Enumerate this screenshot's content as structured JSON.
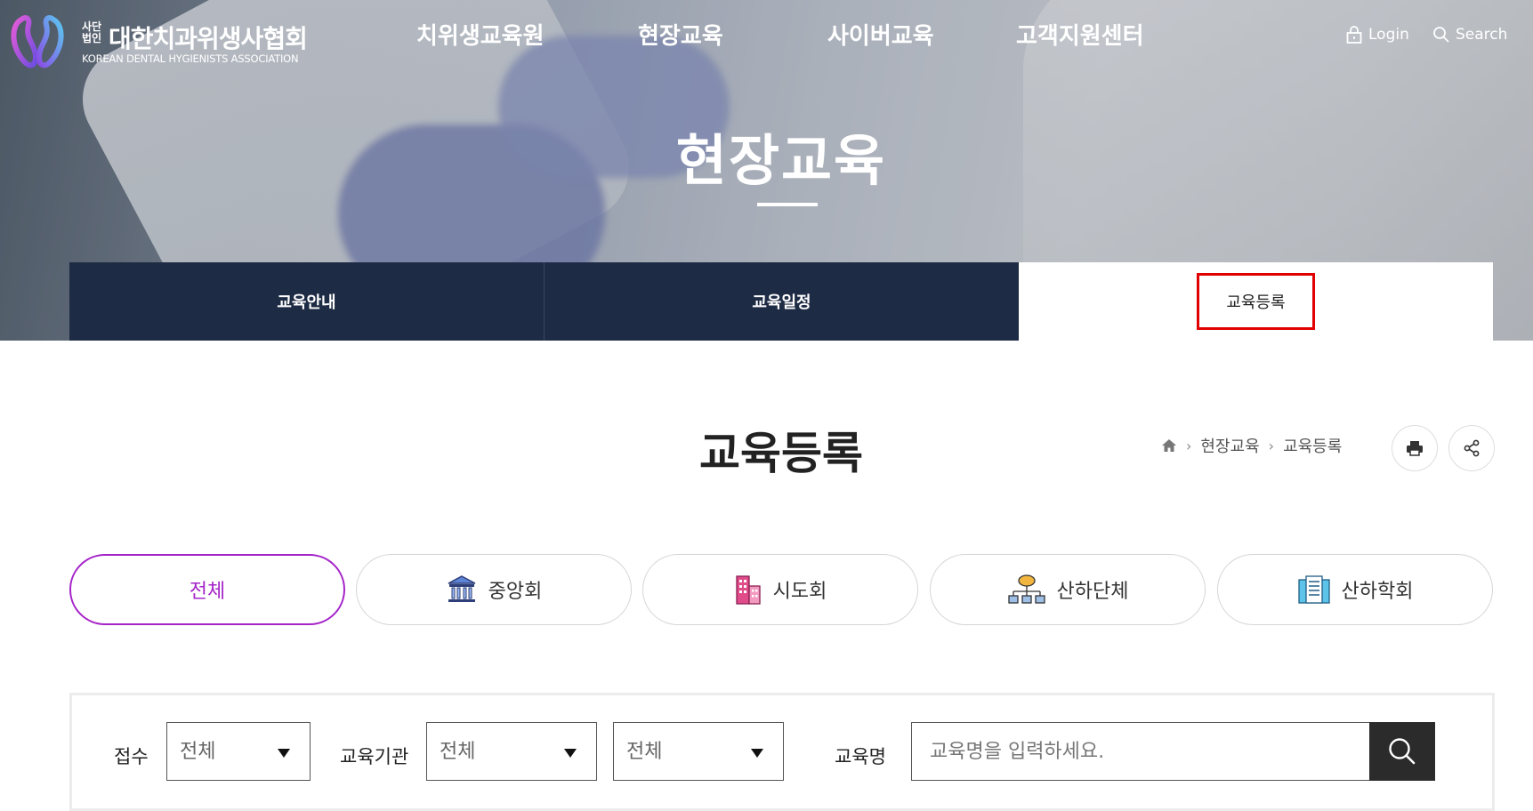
{
  "header": {
    "logo_small": "사단\n법인",
    "logo_name": "대한치과위생사협회",
    "logo_sub": "KOREAN DENTAL HYGIENISTS ASSOCIATION",
    "nav": [
      "치위생교육원",
      "현장교육",
      "사이버교육",
      "고객지원센터"
    ],
    "login": "Login",
    "search": "Search"
  },
  "hero": {
    "title": "현장교육"
  },
  "tabs": [
    {
      "label": "교육안내",
      "active": false
    },
    {
      "label": "교육일정",
      "active": false
    },
    {
      "label": "교육등록",
      "active": true
    }
  ],
  "page": {
    "title": "교육등록",
    "breadcrumb": [
      "현장교육",
      "교육등록"
    ]
  },
  "categories": [
    {
      "label": "전체",
      "icon": "",
      "active": true
    },
    {
      "label": "중앙회",
      "icon": "institution-icon",
      "active": false
    },
    {
      "label": "시도회",
      "icon": "building-icon",
      "active": false
    },
    {
      "label": "산하단체",
      "icon": "org-chart-icon",
      "active": false
    },
    {
      "label": "산하학회",
      "icon": "document-building-icon",
      "active": false
    }
  ],
  "search": {
    "reception_label": "접수",
    "reception_value": "전체",
    "institution_label": "교육기관",
    "institution_value_1": "전체",
    "institution_value_2": "전체",
    "course_label": "교육명",
    "course_placeholder": "교육명을 입력하세요."
  },
  "colors": {
    "navy": "#1e2b44",
    "accent": "#a524c9",
    "highlight": "#e00000"
  }
}
